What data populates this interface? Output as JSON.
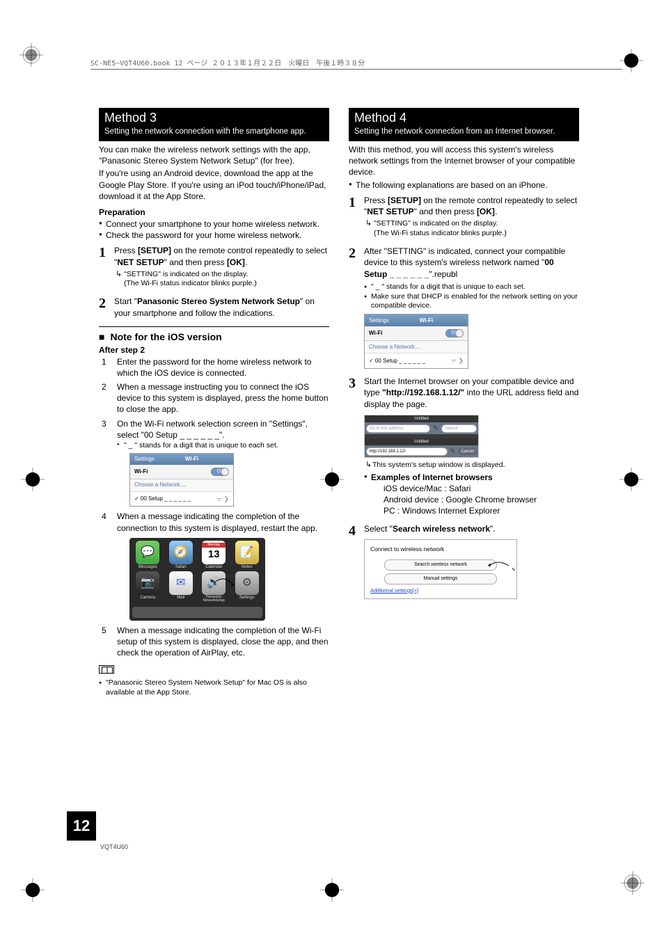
{
  "header_line": "SC-NE5~VQT4U60.book  12 ページ  ２０１３年１月２２日　火曜日　午後１時３８分",
  "method3": {
    "title": "Method 3",
    "sub": "Setting the network connection with the smartphone app.",
    "intro1": "You can make the wireless network settings with the app, \"Panasonic Stereo System Network Setup\" (for free).",
    "intro2": "If you're using an Android device, download the app at the Google Play Store. If you're using an iPod touch/iPhone/iPad, download it at the App Store.",
    "prep_title": "Preparation",
    "prep_bullets": [
      "Connect your smartphone to your home wireless network.",
      "Check the password for your home wireless network."
    ],
    "step1_a": "Press ",
    "step1_b": "[SETUP]",
    "step1_c": " on the remote control repeatedly to select \"",
    "step1_d": "NET SETUP",
    "step1_e": "\" and then press ",
    "step1_f": "[OK]",
    "step1_g": ".",
    "step1_sub1": "\"SETTING\" is indicated on the display.",
    "step1_sub2": "(The Wi-Fi status indicator blinks purple.)",
    "step2_a": "Start \"",
    "step2_b": "Panasonic Stereo System Network Setup",
    "step2_c": "\" on your smartphone and follow the indications.",
    "ios_title": "Note for the iOS version",
    "after_step2": "After step 2",
    "ios_steps": {
      "s1": "Enter the password for the home wireless network to which the iOS device is connected.",
      "s2": "When a message instructing you to connect the iOS device to this system is displayed, press the home button to close the app.",
      "s3a": "On the Wi-Fi network selection screen in \"Settings\", select \"00 Setup _ _ _ _ _ _\".",
      "s3b": "\" _ \" stands for a digit that is unique to each set.",
      "s4": "When a message indicating the completion of the connection to this system is displayed, restart the app.",
      "s5": "When a message indicating the completion of the Wi-Fi setup of this system is displayed, close the app, and then check the operation of AirPlay, etc."
    },
    "wifi_fig": {
      "back": "Settings",
      "title": "Wi-Fi",
      "wifi_label": "Wi-Fi",
      "on": "ON",
      "choose": "Choose a Network....",
      "net": "✓ 00 Setup _ _ _ _ _ _"
    },
    "home_icons": {
      "r1": [
        "Messages",
        "Safari",
        "Calendar",
        "Notes"
      ],
      "r2": [
        "Camera",
        "Mail",
        "Panasonic NetworkSetup",
        "Settings"
      ],
      "cal_day": "Monday",
      "cal_num": "13"
    },
    "footnote": "\"Panasonic Stereo System Network Setup\" for Mac OS is also available at the App Store."
  },
  "method4": {
    "title": "Method 4",
    "sub": "Setting the network connection from an Internet browser.",
    "intro": "With this method, you will access this system's wireless network settings from the Internet browser of your compatible device.",
    "intro_bullet": "The following explanations are based on an iPhone.",
    "step1_a": "Press ",
    "step1_b": "[SETUP]",
    "step1_c": " on the remote control repeatedly to select \"",
    "step1_d": "NET SETUP",
    "step1_e": "\" and then press ",
    "step1_f": "[OK]",
    "step1_g": ".",
    "step1_sub1": "\"SETTING\" is indicated on the display.",
    "step1_sub2": "(The Wi-Fi status indicator blinks purple.)",
    "step2_a": "After \"SETTING\" is indicated, connect your compatible device to this system's wireless network named \"",
    "step2_b": "00 Setup _ _ _ _ _ _",
    "step2_c": "\".",
    "step2_bullets": [
      "\" _ \" stands for a digit that is unique to each set.",
      "Make sure that DHCP is enabled for the network setting on your compatible device."
    ],
    "step3_a": "Start the Internet browser on your compatible device and type ",
    "step3_b": "\"http://192.168.1.12/\"",
    "step3_c": " into the URL address field and display the page.",
    "browser_fig": {
      "tab1": "Untitled",
      "addr_ph": "Go to this address",
      "search": "Search",
      "tab2": "Untitled",
      "url": "http://192.168.1.12/",
      "cancel": "Cancel"
    },
    "step3_sub": "This system's setup window is displayed.",
    "examples_title": "Examples of Internet browsers",
    "examples": [
      "iOS device/Mac : Safari",
      "Android device : Google Chrome browser",
      "PC : Windows Internet Explorer"
    ],
    "step4_a": "Select \"",
    "step4_b": "Search wireless network",
    "step4_c": "\".",
    "setup_fig": {
      "title": "Connect to wireless network",
      "btn1": "Search wireless network",
      "btn2": "Manual settings",
      "link": "Additional settings[+]"
    }
  },
  "page_number": "12",
  "doc_code": "VQT4U60"
}
